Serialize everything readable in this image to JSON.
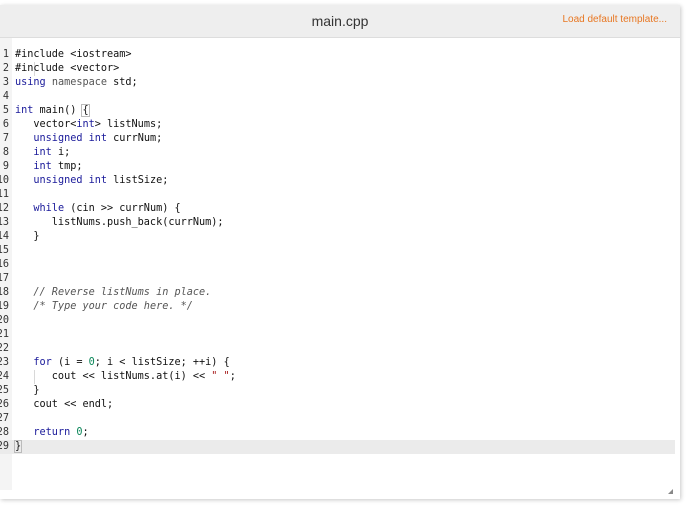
{
  "header": {
    "filename": "main.cpp",
    "load_template_label": "Load default template..."
  },
  "editor": {
    "active_line": 29,
    "lines": [
      {
        "n": "1",
        "tokens": [
          {
            "t": "#include <iostream>"
          }
        ]
      },
      {
        "n": "2",
        "tokens": [
          {
            "t": "#include <vector>"
          }
        ]
      },
      {
        "n": "3",
        "tokens": [
          {
            "t": "using",
            "c": "kw"
          },
          {
            "t": " "
          },
          {
            "t": "namespace",
            "c": "dim"
          },
          {
            "t": " std;"
          }
        ]
      },
      {
        "n": "4",
        "tokens": []
      },
      {
        "n": "5",
        "tokens": [
          {
            "t": "int",
            "c": "kw"
          },
          {
            "t": " main() "
          },
          {
            "t": "{",
            "c": "match"
          }
        ]
      },
      {
        "n": "6",
        "tokens": [
          {
            "t": "   vector<"
          },
          {
            "t": "int",
            "c": "kw"
          },
          {
            "t": "> listNums;"
          }
        ]
      },
      {
        "n": "7",
        "tokens": [
          {
            "t": "   "
          },
          {
            "t": "unsigned",
            "c": "kw"
          },
          {
            "t": " "
          },
          {
            "t": "int",
            "c": "kw"
          },
          {
            "t": " currNum;"
          }
        ]
      },
      {
        "n": "8",
        "tokens": [
          {
            "t": "   "
          },
          {
            "t": "int",
            "c": "kw"
          },
          {
            "t": " i;"
          }
        ]
      },
      {
        "n": "9",
        "tokens": [
          {
            "t": "   "
          },
          {
            "t": "int",
            "c": "kw"
          },
          {
            "t": " tmp;"
          }
        ]
      },
      {
        "n": "10",
        "tokens": [
          {
            "t": "   "
          },
          {
            "t": "unsigned",
            "c": "kw"
          },
          {
            "t": " "
          },
          {
            "t": "int",
            "c": "kw"
          },
          {
            "t": " listSize;"
          }
        ]
      },
      {
        "n": "11",
        "tokens": []
      },
      {
        "n": "12",
        "tokens": [
          {
            "t": "   "
          },
          {
            "t": "while",
            "c": "kw"
          },
          {
            "t": " (cin >> currNum) {"
          }
        ]
      },
      {
        "n": "13",
        "tokens": [
          {
            "t": "      listNums.push_back(currNum);"
          }
        ]
      },
      {
        "n": "14",
        "tokens": [
          {
            "t": "   }"
          }
        ]
      },
      {
        "n": "15",
        "tokens": []
      },
      {
        "n": "16",
        "tokens": []
      },
      {
        "n": "17",
        "tokens": []
      },
      {
        "n": "18",
        "tokens": [
          {
            "t": "   "
          },
          {
            "t": "// Reverse listNums in place.",
            "c": "cm"
          }
        ]
      },
      {
        "n": "19",
        "tokens": [
          {
            "t": "   "
          },
          {
            "t": "/* Type your code here. */",
            "c": "cm"
          }
        ]
      },
      {
        "n": "20",
        "tokens": []
      },
      {
        "n": "21",
        "tokens": []
      },
      {
        "n": "22",
        "tokens": []
      },
      {
        "n": "23",
        "tokens": [
          {
            "t": "   "
          },
          {
            "t": "for",
            "c": "kw"
          },
          {
            "t": " (i = "
          },
          {
            "t": "0",
            "c": "num"
          },
          {
            "t": "; i < listSize; ++i) {"
          }
        ]
      },
      {
        "n": "24",
        "tokens": [
          {
            "t": "      cout << listNums.at(i) << "
          },
          {
            "t": "\" \"",
            "c": "str"
          },
          {
            "t": ";"
          }
        ]
      },
      {
        "n": "25",
        "tokens": [
          {
            "t": "   }"
          }
        ]
      },
      {
        "n": "26",
        "tokens": [
          {
            "t": "   cout << endl;"
          }
        ]
      },
      {
        "n": "27",
        "tokens": []
      },
      {
        "n": "28",
        "tokens": [
          {
            "t": "   "
          },
          {
            "t": "return",
            "c": "kw"
          },
          {
            "t": " "
          },
          {
            "t": "0",
            "c": "num"
          },
          {
            "t": ";"
          }
        ]
      },
      {
        "n": "29",
        "tokens": [
          {
            "t": "}",
            "c": "match"
          }
        ]
      }
    ]
  }
}
